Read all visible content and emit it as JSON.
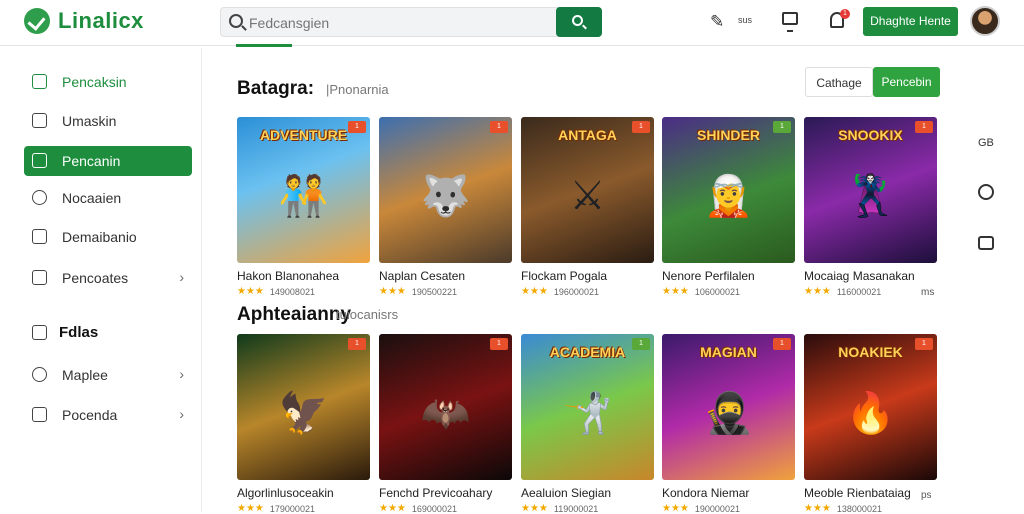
{
  "header": {
    "logo_text": "Linalicx",
    "search_placeholder": "Fedcansgien",
    "pencil_label": "sus",
    "bell_badge": "1",
    "cta_label": "Dhaghte Hente"
  },
  "sidebar": {
    "items": [
      {
        "label": "Pencaksin"
      },
      {
        "label": "Umaskin"
      },
      {
        "label": "Pencanin"
      },
      {
        "label": "Nocaaien"
      },
      {
        "label": "Demaibanio"
      },
      {
        "label": "Pencoates"
      }
    ],
    "section_label": "Fdlas",
    "section_items": [
      {
        "label": "Maplee"
      },
      {
        "label": "Pocenda"
      }
    ]
  },
  "sections": [
    {
      "title": "Batagra:",
      "subtitle": "|Pnonarnia",
      "buttons": [
        "Cathage",
        "Pencebin"
      ],
      "cards": [
        {
          "name": "Hakon Blanonahea",
          "meta": "149008021",
          "tag": "1"
        },
        {
          "name": "Naplan Cesaten",
          "meta": "190500221",
          "tag": "1"
        },
        {
          "name": "Flockam Pogala",
          "meta": "196000021",
          "tag": "1"
        },
        {
          "name": "Nenore Perfilalen",
          "meta": "106000021",
          "tag": "1"
        },
        {
          "name": "Mocaiag Masanakan",
          "meta": "116000021",
          "tag": "1"
        }
      ],
      "more": "ms"
    },
    {
      "title": "Aphteaianny",
      "subtitle": "tuiocanisrs",
      "cards": [
        {
          "name": "Algorlinlusoceakin",
          "meta": "179000021",
          "tag": "1"
        },
        {
          "name": "Fenchd Previcoahary",
          "meta": "169000021",
          "tag": "1"
        },
        {
          "name": "Aealuion Siegian",
          "meta": "119000021",
          "tag": "1"
        },
        {
          "name": "Kondora Niemar",
          "meta": "190000021",
          "tag": "1"
        },
        {
          "name": "Meoble Rienbataiag",
          "meta": "138000021",
          "tag": "1"
        }
      ],
      "more": "ps"
    }
  ],
  "thumb_titles": [
    "ADVENTURE",
    "",
    "ANTAGA",
    "SHINDER",
    "SNOOKIX",
    "",
    "",
    "ACADEMIA",
    "MAGIAN",
    "NOAKIEK"
  ],
  "side_tools": {
    "top_label": "GB"
  }
}
